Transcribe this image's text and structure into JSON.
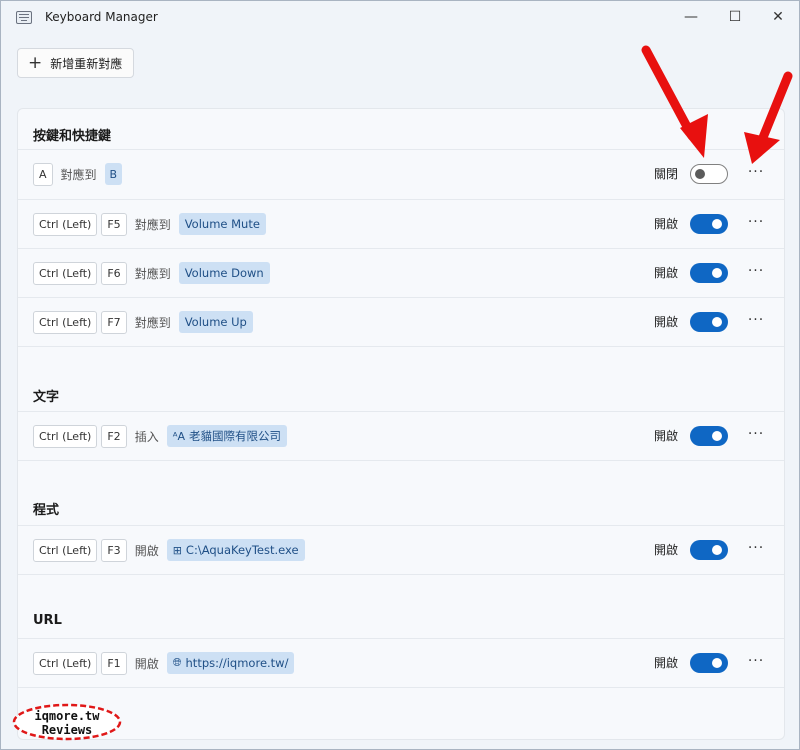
{
  "window": {
    "title": "Keyboard Manager"
  },
  "titlebar_buttons": {
    "minimize": "—",
    "maximize": "☐",
    "close": "✕"
  },
  "toolbar": {
    "add_label": "新增重新對應",
    "add_icon": "+"
  },
  "sections": [
    {
      "title": "按鍵和快捷鍵",
      "rows": [
        {
          "keys": [
            "A"
          ],
          "verb": "對應到",
          "target": "B",
          "status": "關閉",
          "enabled": false
        },
        {
          "keys": [
            "Ctrl (Left)",
            "F5"
          ],
          "verb": "對應到",
          "target": "Volume Mute",
          "status": "開啟",
          "enabled": true
        },
        {
          "keys": [
            "Ctrl (Left)",
            "F6"
          ],
          "verb": "對應到",
          "target": "Volume Down",
          "status": "開啟",
          "enabled": true
        },
        {
          "keys": [
            "Ctrl (Left)",
            "F7"
          ],
          "verb": "對應到",
          "target": "Volume Up",
          "status": "開啟",
          "enabled": true
        }
      ]
    },
    {
      "title": "文字",
      "rows": [
        {
          "keys": [
            "Ctrl (Left)",
            "F2"
          ],
          "verb": "插入",
          "target": "老貓國際有限公司",
          "target_icon": "text-icon",
          "status": "開啟",
          "enabled": true
        }
      ]
    },
    {
      "title": "程式",
      "rows": [
        {
          "keys": [
            "Ctrl (Left)",
            "F3"
          ],
          "verb": "開啟",
          "target": "C:\\AquaKeyTest.exe",
          "target_icon": "app-icon",
          "status": "開啟",
          "enabled": true
        }
      ]
    },
    {
      "title": "URL",
      "rows": [
        {
          "keys": [
            "Ctrl (Left)",
            "F1"
          ],
          "verb": "開啟",
          "target": "https://iqmore.tw/",
          "target_icon": "globe-icon",
          "status": "開啟",
          "enabled": true
        }
      ]
    }
  ],
  "more_label": "···",
  "watermark": {
    "line1": "iqmore.tw",
    "line2": "Reviews"
  },
  "colors": {
    "accent": "#0f67c4",
    "annotation": "#e8100f",
    "chip": "#cde0f4"
  }
}
